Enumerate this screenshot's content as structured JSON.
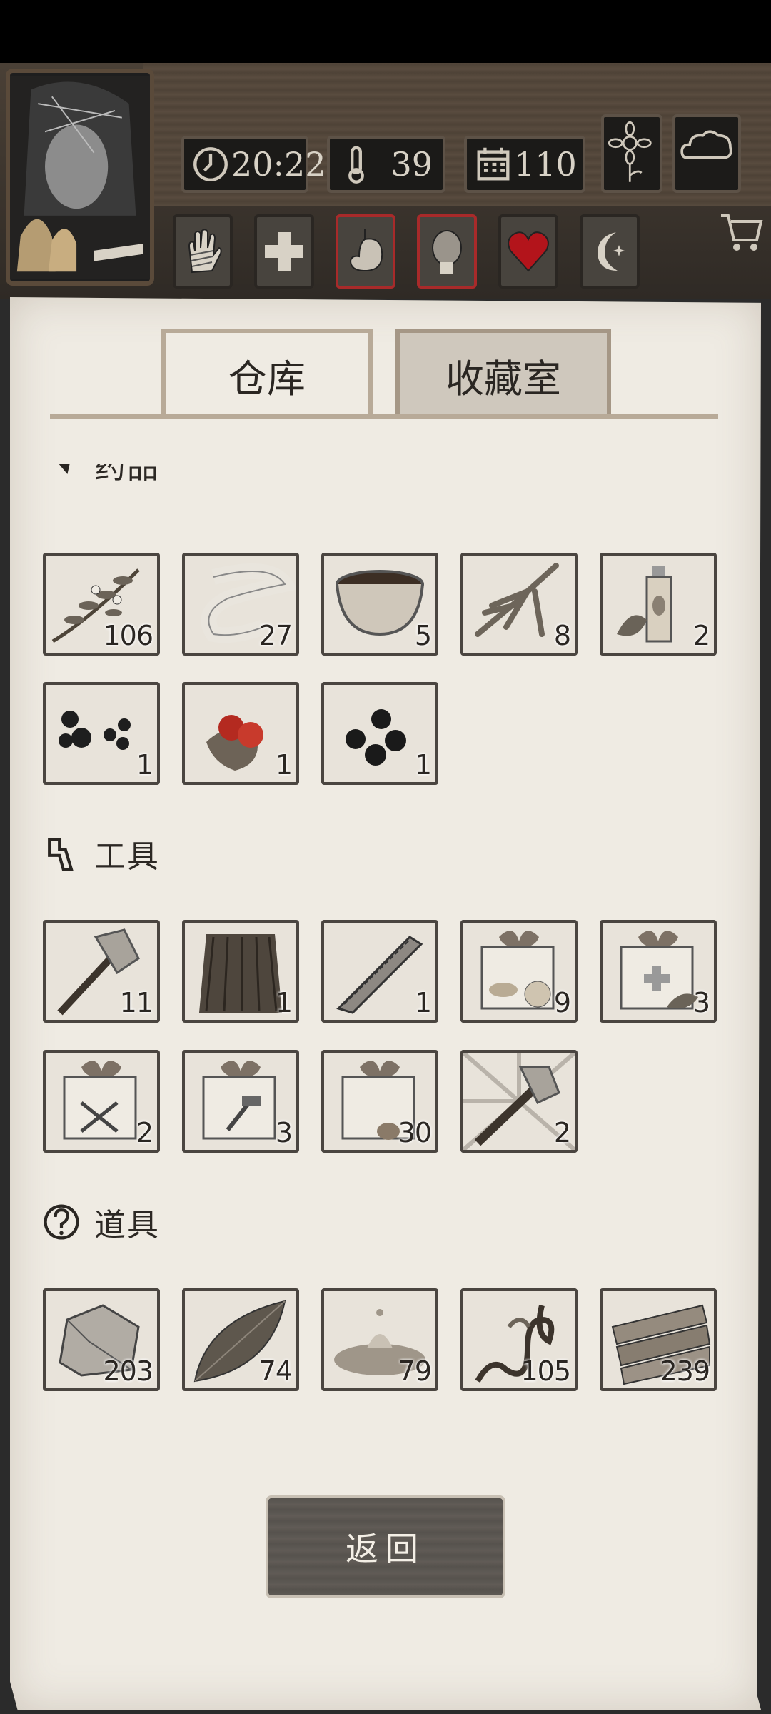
{
  "hud": {
    "time": "20:22",
    "temperature": "39",
    "day": "110",
    "icons": [
      "clock-icon",
      "thermometer-icon",
      "calendar-icon",
      "sunflower-icon",
      "cloud-icon"
    ],
    "stats": [
      "bandaged-hand-icon",
      "health-cross-icon",
      "stomach-icon",
      "head-icon",
      "heart-icon",
      "moon-icon"
    ]
  },
  "tabs": {
    "warehouse": "仓库",
    "collection": "收藏室"
  },
  "sections": {
    "medicine": {
      "label": "药品",
      "icon": "pill-icon"
    },
    "tools": {
      "label": "工具",
      "icon": "wrench-icon"
    },
    "props": {
      "label": "道具",
      "icon": "question-icon"
    }
  },
  "medicine_items": [
    {
      "name": "herb",
      "qty": "106"
    },
    {
      "name": "bandage",
      "qty": "27"
    },
    {
      "name": "medicine-bowl",
      "qty": "5"
    },
    {
      "name": "ginseng",
      "qty": "8"
    },
    {
      "name": "herbal-bottle",
      "qty": "2"
    },
    {
      "name": "black-pills",
      "qty": "1"
    },
    {
      "name": "red-berries",
      "qty": "1"
    },
    {
      "name": "black-berries",
      "qty": "1"
    }
  ],
  "tool_items": [
    {
      "name": "stone-axe",
      "qty": "11"
    },
    {
      "name": "grass-skirt",
      "qty": "1"
    },
    {
      "name": "saw-blade",
      "qty": "1"
    },
    {
      "name": "food-gift-box",
      "qty": "9"
    },
    {
      "name": "herb-gift-box",
      "qty": "3"
    },
    {
      "name": "weapon-gift-box",
      "qty": "2"
    },
    {
      "name": "tool-gift-box",
      "qty": "3"
    },
    {
      "name": "material-gift-box",
      "qty": "30"
    },
    {
      "name": "special-axe",
      "qty": "2"
    }
  ],
  "prop_items": [
    {
      "name": "stone",
      "qty": "203"
    },
    {
      "name": "leaf",
      "qty": "74"
    },
    {
      "name": "water-puddle",
      "qty": "79"
    },
    {
      "name": "vine",
      "qty": "105"
    },
    {
      "name": "wood-planks",
      "qty": "239"
    }
  ],
  "back_button": "返回"
}
